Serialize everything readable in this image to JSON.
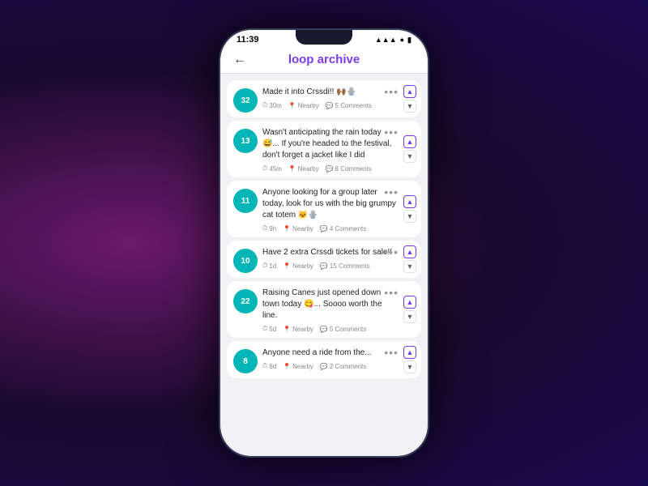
{
  "status_bar": {
    "time": "11:39",
    "icons": "▲ ● ■"
  },
  "header": {
    "back_label": "←",
    "title": "loop archive"
  },
  "posts": [
    {
      "id": 1,
      "vote_count": "32",
      "text": "Made it into Crssdi!! 🙌🏾🪬",
      "time": "30m",
      "location": "Nearby",
      "comments": "5 Comments"
    },
    {
      "id": 2,
      "vote_count": "13",
      "text": "Wasn't anticipating the rain today 😅... If you're headed to the festival, don't forget a jacket like I did",
      "time": "45m",
      "location": "Nearby",
      "comments": "8 Comments"
    },
    {
      "id": 3,
      "vote_count": "11",
      "text": "Anyone looking for a group later today, look for us with the big grumpy cat totem 🐱🪬",
      "time": "9h",
      "location": "Nearby",
      "comments": "4 Comments"
    },
    {
      "id": 4,
      "vote_count": "10",
      "text": "Have 2 extra Crssdi tickets for sale!!",
      "time": "1d",
      "location": "Nearby",
      "comments": "15 Comments"
    },
    {
      "id": 5,
      "vote_count": "22",
      "text": "Raising Canes just opened down town today 😋... Soooo worth the line.",
      "time": "5d",
      "location": "Nearby",
      "comments": "5 Comments"
    },
    {
      "id": 6,
      "vote_count": "8",
      "text": "Anyone need a ride from the...",
      "time": "6d",
      "location": "Nearby",
      "comments": "2 Comments"
    }
  ],
  "icons": {
    "back": "←",
    "clock": "🕐",
    "pin": "📍",
    "comment": "💬",
    "dots": "•••",
    "up_arrow": "▲",
    "down_arrow": "▼"
  }
}
